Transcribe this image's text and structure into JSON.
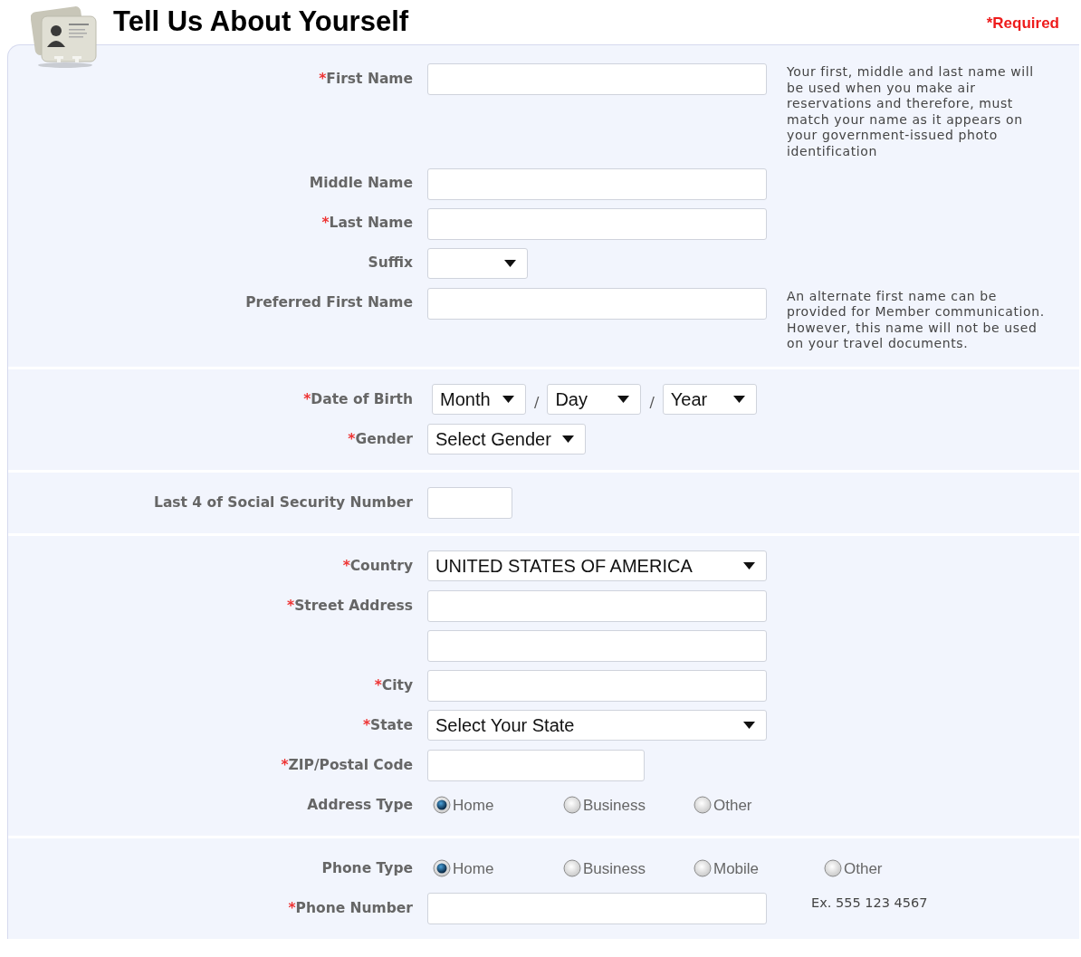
{
  "header": {
    "title": "Tell Us About Yourself",
    "required_note": "*Required"
  },
  "sections": [
    {
      "rows": [
        {
          "kind": "text",
          "mark": "*",
          "label": "First Name",
          "note": "Your first, middle and last name will be used when you make air reservations and therefore, must match your name as it appears on your government-issued photo identification"
        },
        {
          "kind": "text",
          "label": "Middle Name"
        },
        {
          "kind": "text",
          "mark": "*",
          "label": "Last Name"
        },
        {
          "kind": "select_short",
          "label": "Suffix"
        },
        {
          "kind": "text",
          "label": "Preferred First Name",
          "note": "An alternate first name can be provided for Member communication. However, this name will not be used on your travel documents."
        }
      ]
    },
    {
      "rows": [
        {
          "kind": "date",
          "mark": "*",
          "label": "Date of Birth",
          "parts": [
            "Month",
            "Day",
            "Year"
          ],
          "separators": [
            "/",
            "/"
          ]
        },
        {
          "kind": "select_medium",
          "mark": "*",
          "label": "Gender",
          "value": "Select Gender"
        }
      ]
    },
    {
      "rows": [
        {
          "kind": "ssn",
          "label": "Last 4 of Social Security Number"
        }
      ]
    },
    {
      "rows": [
        {
          "kind": "select_long",
          "mark": "*",
          "label": "Country",
          "value": "UNITED STATES OF AMERICA"
        },
        {
          "kind": "text",
          "mark": "*",
          "label": "Street Address"
        },
        {
          "kind": "text"
        },
        {
          "kind": "text",
          "mark": "*",
          "label": "City"
        },
        {
          "kind": "select_long",
          "mark": "*",
          "label": "State",
          "value": "Select Your State"
        },
        {
          "kind": "zip",
          "mark": "*",
          "label": "ZIP/Postal Code"
        },
        {
          "kind": "radio",
          "label": "Address Type",
          "options": [
            {
              "label": "Home",
              "selected": true
            },
            {
              "label": "Business",
              "selected": false
            },
            {
              "label": "Other",
              "selected": false
            }
          ]
        }
      ]
    },
    {
      "rows": [
        {
          "kind": "radio",
          "label": "Phone Type",
          "options": [
            {
              "label": "Home",
              "selected": true
            },
            {
              "label": "Business",
              "selected": false
            },
            {
              "label": "Mobile",
              "selected": false
            },
            {
              "label": "Other",
              "selected": false
            }
          ]
        },
        {
          "kind": "text",
          "mark": "*",
          "label": "Phone Number",
          "hint": "Ex. 555 123 4567"
        }
      ]
    }
  ]
}
